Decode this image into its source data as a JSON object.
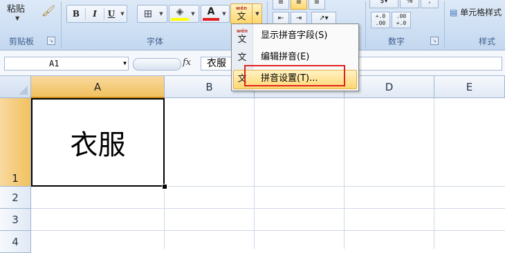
{
  "ribbon": {
    "clipboard": {
      "paste_label": "粘贴",
      "group_label": "剪贴板"
    },
    "font": {
      "group_label": "字体",
      "bold": "B",
      "italic": "I",
      "underline": "U",
      "font_color_letter": "A",
      "phonetic_top": "wén",
      "phonetic_char": "文"
    },
    "number": {
      "group_label": "数字",
      "percent": "%",
      "comma": ",",
      "inc_decimal": "+.0\n.00",
      "dec_decimal": ".00\n+.0"
    },
    "styles": {
      "group_label": "样式",
      "cell_styles": "单元格样式"
    }
  },
  "formula_bar": {
    "name_box": "A1",
    "fx": "fx",
    "content": "衣服"
  },
  "grid": {
    "columns": [
      "A",
      "B",
      "C",
      "D",
      "E"
    ],
    "rows": [
      "1",
      "2",
      "3",
      "4"
    ],
    "cell_a1": "衣服"
  },
  "menu": {
    "items": [
      {
        "label": "显示拼音字段(S)",
        "hotkey": "S"
      },
      {
        "label": "编辑拼音(E)",
        "hotkey": "E"
      },
      {
        "label": "拼音设置(T)...",
        "hotkey": "T"
      }
    ]
  },
  "colors": {
    "accent": "#f1c15f",
    "highlight_box": "#e02020",
    "ribbon_bg": "#cfe0f4"
  }
}
